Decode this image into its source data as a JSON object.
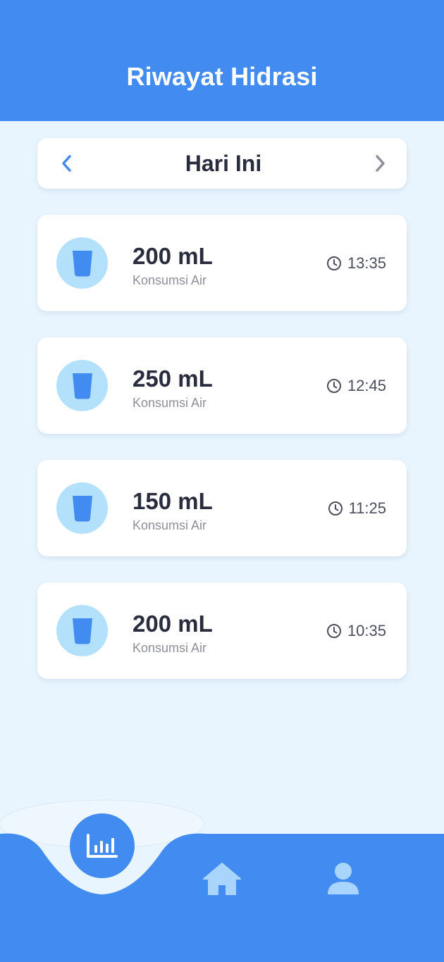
{
  "header": {
    "title": "Riwayat Hidrasi"
  },
  "day_nav": {
    "title": "Hari Ini",
    "prev_icon": "chevron-left-icon",
    "next_icon": "chevron-right-icon"
  },
  "entries": [
    {
      "amount": "200 mL",
      "label": "Konsumsi Air",
      "time": "13:35"
    },
    {
      "amount": "250 mL",
      "label": "Konsumsi Air",
      "time": "12:45"
    },
    {
      "amount": "150 mL",
      "label": "Konsumsi Air",
      "time": "11:25"
    },
    {
      "amount": "200 mL",
      "label": "Konsumsi Air",
      "time": "10:35"
    }
  ],
  "bottom_nav": {
    "items": [
      {
        "icon": "bar-chart-icon",
        "active": true
      },
      {
        "icon": "home-icon",
        "active": false
      },
      {
        "icon": "user-icon",
        "active": false
      }
    ]
  },
  "colors": {
    "primary": "#428CF1",
    "background": "#E9F5FE",
    "cup_circle": "#B3E1FB",
    "cup": "#428CF1",
    "text_dark": "#2A2D3E",
    "text_muted": "#8E8F9B",
    "inactive_icon": "#A9D4FB"
  }
}
